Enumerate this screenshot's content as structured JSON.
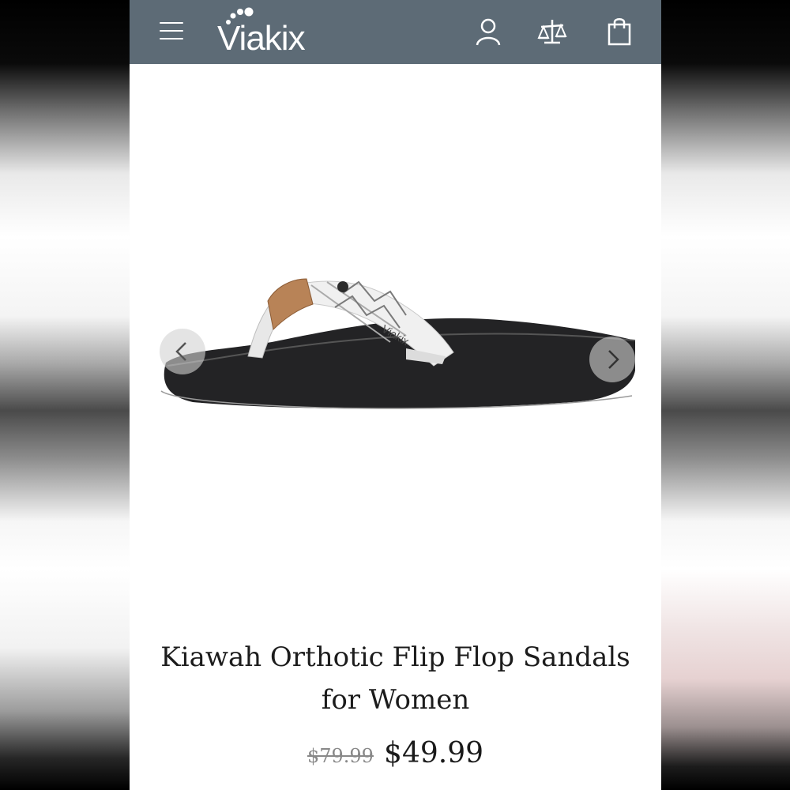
{
  "header": {
    "brand": "Viakix",
    "icons": [
      "menu-icon",
      "account-icon",
      "compare-icon",
      "cart-icon"
    ],
    "background_color": "#5d6b76"
  },
  "gallery": {
    "prev_icon": "chevron-left-icon",
    "next_icon": "chevron-right-icon"
  },
  "product": {
    "title_line1": "Kiawah Orthotic Flip Flop Sandals",
    "title_line2": "for Women",
    "original_price": "$79.99",
    "sale_price": "$49.99",
    "strap_text": "Viakix"
  }
}
